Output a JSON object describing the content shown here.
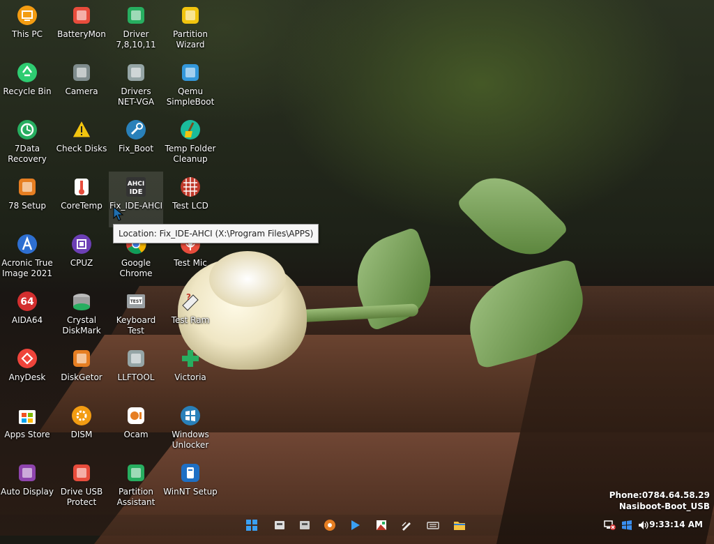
{
  "desktop": {
    "icons": [
      {
        "label": "This PC",
        "icon": "this-pc-icon",
        "color": "#f39c12"
      },
      {
        "label": "BatteryMon",
        "icon": "batterymon-icon",
        "color": "#e74c3c"
      },
      {
        "label": "Driver\n7,8,10,11",
        "icon": "driver-icon",
        "color": "#27ae60"
      },
      {
        "label": "Partition\nWizard",
        "icon": "partition-wizard-icon",
        "color": "#f1c40f"
      },
      {
        "label": "Recycle Bin",
        "icon": "recycle-bin-icon",
        "color": "#2ecc71"
      },
      {
        "label": "Camera",
        "icon": "camera-icon",
        "color": "#7f8c8d"
      },
      {
        "label": "Drivers\nNET-VGA",
        "icon": "drivers-net-vga-icon",
        "color": "#95a5a6"
      },
      {
        "label": "Qemu\nSimpleBoot",
        "icon": "qemu-icon",
        "color": "#3498db"
      },
      {
        "label": "7Data\nRecovery",
        "icon": "data-recovery-icon",
        "color": "#27ae60"
      },
      {
        "label": "Check Disks",
        "icon": "check-disks-icon",
        "color": "#f1c40f"
      },
      {
        "label": "Fix_Boot",
        "icon": "wrench-icon",
        "color": "#2980b9"
      },
      {
        "label": "Temp Folder\nCleanup",
        "icon": "broom-icon",
        "color": "#1abc9c"
      },
      {
        "label": "78 Setup",
        "icon": "setup-icon",
        "color": "#e67e22"
      },
      {
        "label": "CoreTemp",
        "icon": "thermometer-icon",
        "color": "#e74c3c"
      },
      {
        "label": "Fix_IDE-AHCI",
        "icon": "ahci-ide-icon",
        "color": "#333333"
      },
      {
        "label": "Test LCD",
        "icon": "test-lcd-icon",
        "color": "#c0392b"
      },
      {
        "label": "Acronic True\nImage 2021",
        "icon": "acronis-icon",
        "color": "#2e6fd1"
      },
      {
        "label": "CPUZ",
        "icon": "cpu-icon",
        "color": "#6c3fb5"
      },
      {
        "label": "Google\nChrome",
        "icon": "chrome-icon",
        "color": "#4285f4"
      },
      {
        "label": "Test Mic",
        "icon": "microphone-icon",
        "color": "#e74c3c"
      },
      {
        "label": "AIDA64",
        "icon": "aida64-icon",
        "color": "#d32f2f"
      },
      {
        "label": "Crystal\nDiskMark",
        "icon": "crystal-diskmark-icon",
        "color": "#27ae60"
      },
      {
        "label": "Keyboard\nTest",
        "icon": "keyboard-test-icon",
        "color": "#7f8c8d"
      },
      {
        "label": "Test Ram",
        "icon": "ram-icon",
        "color": "#c0392b"
      },
      {
        "label": "AnyDesk",
        "icon": "anydesk-icon",
        "color": "#ef443b"
      },
      {
        "label": "DiskGetor",
        "icon": "diskgetor-icon",
        "color": "#e67e22"
      },
      {
        "label": "LLFTOOL",
        "icon": "llftool-icon",
        "color": "#95a5a6"
      },
      {
        "label": "Victoria",
        "icon": "victoria-icon",
        "color": "#27ae60"
      },
      {
        "label": "Apps Store",
        "icon": "store-icon",
        "color": "#0078d4"
      },
      {
        "label": "DISM",
        "icon": "dism-icon",
        "color": "#f39c12"
      },
      {
        "label": "Ocam",
        "icon": "ocam-icon",
        "color": "#e67e22"
      },
      {
        "label": "Windows\nUnlocker",
        "icon": "windows-unlocker-icon",
        "color": "#2980b9"
      },
      {
        "label": "Auto Display",
        "icon": "auto-display-icon",
        "color": "#8e44ad"
      },
      {
        "label": "Drive USB\nProtect",
        "icon": "usb-protect-icon",
        "color": "#e74c3c"
      },
      {
        "label": "Partition\nAssistant",
        "icon": "partition-assistant-icon",
        "color": "#27ae60"
      },
      {
        "label": "WinNT Setup",
        "icon": "winnt-setup-icon",
        "color": "#1e6fc4"
      }
    ],
    "selected": "Fix_IDE-AHCI"
  },
  "tooltip": {
    "text": "Location: Fix_IDE-AHCI (X:\\Program Files\\APPS)"
  },
  "overlay": {
    "phone": "Phone:0784.64.58.29",
    "name": "Nasiboot-Boot_USB"
  },
  "taskbar": {
    "apps": [
      {
        "icon": "start-icon",
        "color": "#3aa0f3"
      },
      {
        "icon": "usb-tool-icon",
        "color": "#dddddd"
      },
      {
        "icon": "disk-tool-icon",
        "color": "#cccccc"
      },
      {
        "icon": "disc-icon",
        "color": "#e67e22"
      },
      {
        "icon": "media-play-icon",
        "color": "#3aa0f3"
      },
      {
        "icon": "image-tool-icon",
        "color": "#c0392b"
      },
      {
        "icon": "pencil-tool-icon",
        "color": "#eeeeee"
      },
      {
        "icon": "keyboard-icon",
        "color": "#dddddd"
      },
      {
        "icon": "folder-icon",
        "color": "#f5c342"
      }
    ],
    "tray": {
      "network": "network-disconnected-icon",
      "windows_flag": "windows-flag-icon",
      "volume": "volume-icon",
      "time": "9:33:14 AM"
    }
  },
  "colors": {
    "tooltip_bg": "#f6f6f6",
    "label_text": "#ffffff",
    "selection": "rgba(255,255,255,0.12)"
  }
}
